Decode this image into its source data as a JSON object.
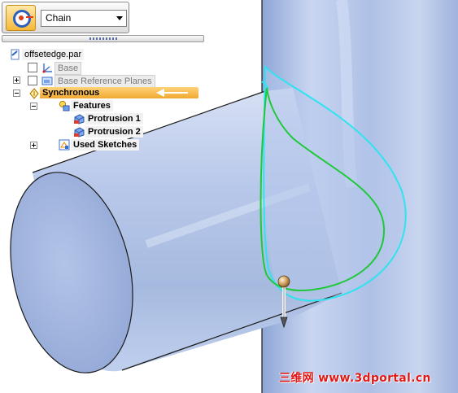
{
  "quickbar": {
    "mode_icon": "select-tool-icon",
    "selection_mode": "Chain",
    "dropdown_icon": "chevron-down-icon"
  },
  "tree": {
    "document": "offsetedge.par",
    "base": "Base",
    "base_reference_planes": "Base Reference Planes",
    "synchronous": "Synchronous",
    "features": "Features",
    "protrusion_1": "Protrusion 1",
    "protrusion_2": "Protrusion 2",
    "used_sketches": "Used Sketches"
  },
  "colors": {
    "selection_highlight": "#f0a830",
    "model_body": "#aabde6",
    "offset_curve": "#2fe3f0",
    "edge_curve": "#1fc93a"
  },
  "watermark": "三维网 www.3dportal.cn"
}
